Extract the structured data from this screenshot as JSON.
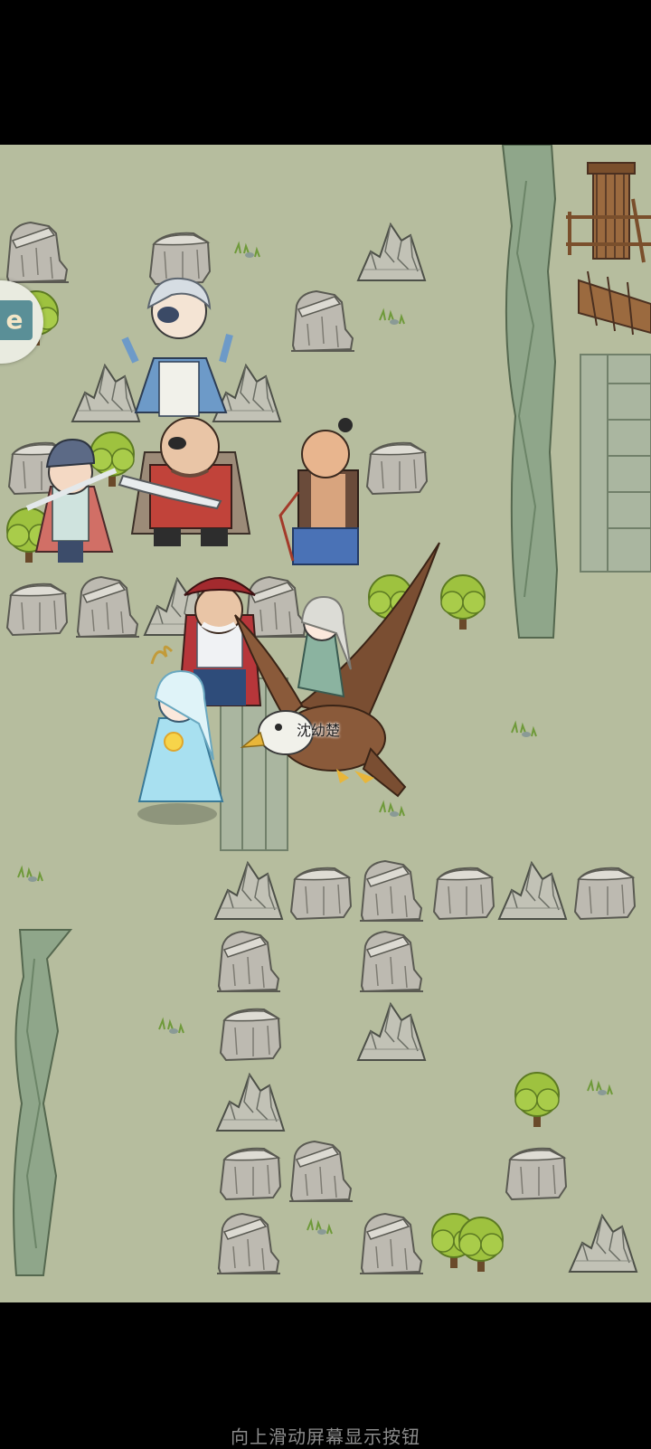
{
  "game": {
    "player_name": "沈幼楚",
    "badge_icon": "game-badge-icon",
    "hint_text": "向上滑动屏幕显示按钮"
  },
  "colors": {
    "ground": "#b6bd9e",
    "rock": "#b8b6ad",
    "tree": "#9ec23f",
    "cliff": "#8fa68a"
  },
  "characters": [
    {
      "name": "white-haired-eyepatch-swordsman",
      "icon": "character-icon"
    },
    {
      "name": "boy-soldier-with-sword",
      "icon": "character-icon"
    },
    {
      "name": "one-eyed-bandit-chief",
      "icon": "character-icon"
    },
    {
      "name": "bald-brute-with-whip",
      "icon": "character-icon"
    },
    {
      "name": "pirate-captain",
      "icon": "character-icon"
    },
    {
      "name": "ice-maiden-mage",
      "icon": "character-icon"
    },
    {
      "name": "shen-youchu-riding-eagle",
      "icon": "player-icon"
    }
  ]
}
